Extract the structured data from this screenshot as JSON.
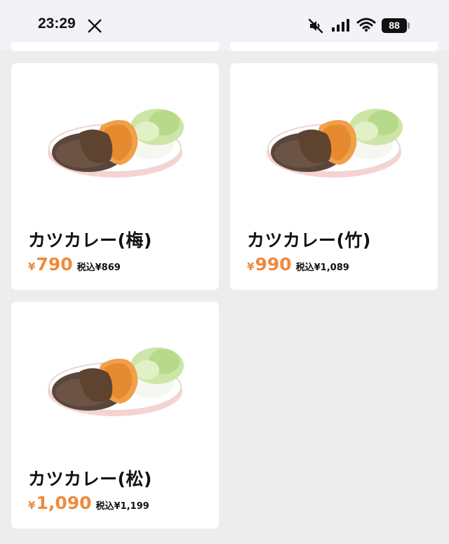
{
  "status_bar": {
    "time": "23:29",
    "battery": "88",
    "icons": [
      "x-app-icon",
      "mute-icon",
      "cellular-signal-icon",
      "wifi-icon",
      "battery-icon"
    ]
  },
  "colors": {
    "price": "#ee8a3c",
    "background": "#ededed",
    "card": "#ffffff"
  },
  "menu_items": [
    {
      "name": "カツカレー(梅)",
      "currency": "¥",
      "price": "790",
      "tax_label": "税込¥869"
    },
    {
      "name": "カツカレー(竹)",
      "currency": "¥",
      "price": "990",
      "tax_label": "税込¥1,089"
    },
    {
      "name": "カツカレー(松)",
      "currency": "¥",
      "price": "1,090",
      "tax_label": "税込¥1,199"
    }
  ]
}
